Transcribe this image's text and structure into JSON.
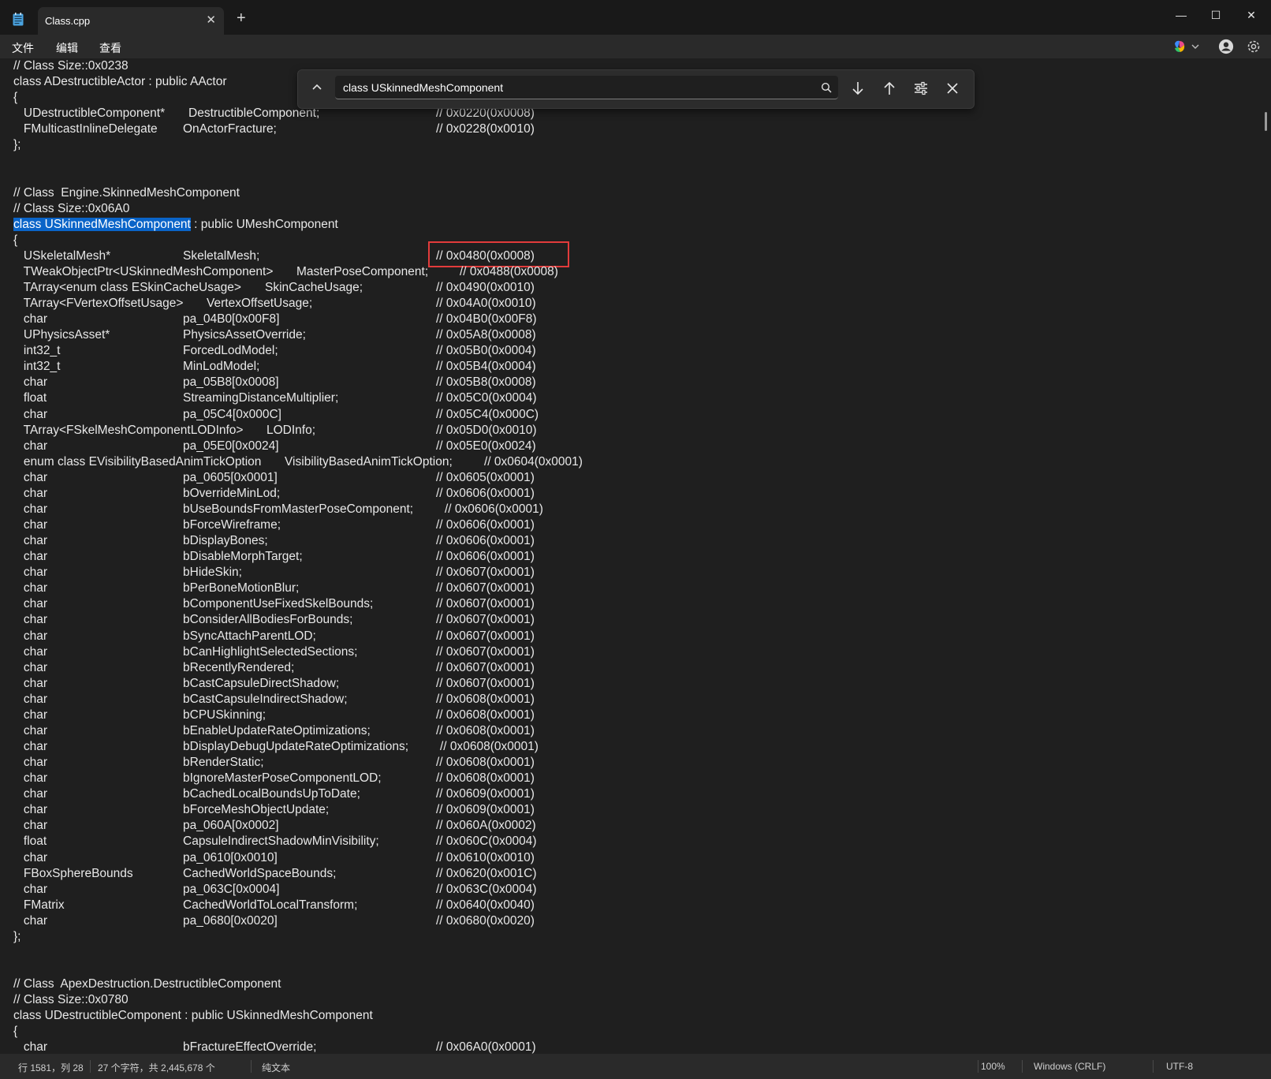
{
  "window": {
    "tab_title": "Class.cpp",
    "tab_close": "✕",
    "new_tab": "+",
    "minimize": "—",
    "maximize": "☐",
    "close": "✕"
  },
  "menu": {
    "file": "文件",
    "edit": "编辑",
    "view": "查看"
  },
  "find": {
    "query": "class USkinnedMeshComponent"
  },
  "editor": {
    "lines": [
      [
        "// Class Size::0x0238"
      ],
      [
        "class ADestructibleActor : public AActor"
      ],
      [
        "{"
      ],
      [
        "   UDestructibleComponent*",
        "DestructibleComponent;",
        "// 0x0220(0x0008)"
      ],
      [
        "   FMulticastInlineDelegate",
        "OnActorFracture;",
        "// 0x0228(0x0010)"
      ],
      [
        "};"
      ],
      [
        ""
      ],
      [
        ""
      ],
      [
        "// Class  Engine.SkinnedMeshComponent"
      ],
      [
        "// Class Size::0x06A0"
      ],
      [
        "class USkinnedMeshComponent",
        " : public UMeshComponent"
      ],
      [
        "{"
      ],
      [
        "   USkeletalMesh*",
        "SkeletalMesh;",
        "// 0x0480(0x0008)"
      ],
      [
        "   TWeakObjectPtr<USkinnedMeshComponent>",
        "MasterPoseComponent;",
        "// 0x0488(0x0008)"
      ],
      [
        "   TArray<enum class ESkinCacheUsage>",
        "SkinCacheUsage;",
        "// 0x0490(0x0010)"
      ],
      [
        "   TArray<FVertexOffsetUsage>",
        "VertexOffsetUsage;",
        "// 0x04A0(0x0010)"
      ],
      [
        "   char",
        "pa_04B0[0x00F8]",
        "// 0x04B0(0x00F8)"
      ],
      [
        "   UPhysicsAsset*",
        "PhysicsAssetOverride;",
        "// 0x05A8(0x0008)"
      ],
      [
        "   int32_t",
        "ForcedLodModel;",
        "// 0x05B0(0x0004)"
      ],
      [
        "   int32_t",
        "MinLodModel;",
        "// 0x05B4(0x0004)"
      ],
      [
        "   char",
        "pa_05B8[0x0008]",
        "// 0x05B8(0x0008)"
      ],
      [
        "   float",
        "StreamingDistanceMultiplier;",
        "// 0x05C0(0x0004)"
      ],
      [
        "   char",
        "pa_05C4[0x000C]",
        "// 0x05C4(0x000C)"
      ],
      [
        "   TArray<FSkelMeshComponentLODInfo>",
        "LODInfo;",
        "// 0x05D0(0x0010)"
      ],
      [
        "   char",
        "pa_05E0[0x0024]",
        "// 0x05E0(0x0024)"
      ],
      [
        "   enum class EVisibilityBasedAnimTickOption",
        "VisibilityBasedAnimTickOption;",
        "// 0x0604(0x0001)"
      ],
      [
        "   char",
        "pa_0605[0x0001]",
        "// 0x0605(0x0001)"
      ],
      [
        "   char",
        "bOverrideMinLod;",
        "// 0x0606(0x0001)"
      ],
      [
        "   char",
        "bUseBoundsFromMasterPoseComponent;",
        "// 0x0606(0x0001)"
      ],
      [
        "   char",
        "bForceWireframe;",
        "// 0x0606(0x0001)"
      ],
      [
        "   char",
        "bDisplayBones;",
        "// 0x0606(0x0001)"
      ],
      [
        "   char",
        "bDisableMorphTarget;",
        "// 0x0606(0x0001)"
      ],
      [
        "   char",
        "bHideSkin;",
        "// 0x0607(0x0001)"
      ],
      [
        "   char",
        "bPerBoneMotionBlur;",
        "// 0x0607(0x0001)"
      ],
      [
        "   char",
        "bComponentUseFixedSkelBounds;",
        "// 0x0607(0x0001)"
      ],
      [
        "   char",
        "bConsiderAllBodiesForBounds;",
        "// 0x0607(0x0001)"
      ],
      [
        "   char",
        "bSyncAttachParentLOD;",
        "// 0x0607(0x0001)"
      ],
      [
        "   char",
        "bCanHighlightSelectedSections;",
        "// 0x0607(0x0001)"
      ],
      [
        "   char",
        "bRecentlyRendered;",
        "// 0x0607(0x0001)"
      ],
      [
        "   char",
        "bCastCapsuleDirectShadow;",
        "// 0x0607(0x0001)"
      ],
      [
        "   char",
        "bCastCapsuleIndirectShadow;",
        "// 0x0608(0x0001)"
      ],
      [
        "   char",
        "bCPUSkinning;",
        "// 0x0608(0x0001)"
      ],
      [
        "   char",
        "bEnableUpdateRateOptimizations;",
        "// 0x0608(0x0001)"
      ],
      [
        "   char",
        "bDisplayDebugUpdateRateOptimizations;",
        "// 0x0608(0x0001)"
      ],
      [
        "   char",
        "bRenderStatic;",
        "// 0x0608(0x0001)"
      ],
      [
        "   char",
        "bIgnoreMasterPoseComponentLOD;",
        "// 0x0608(0x0001)"
      ],
      [
        "   char",
        "bCachedLocalBoundsUpToDate;",
        "// 0x0609(0x0001)"
      ],
      [
        "   char",
        "bForceMeshObjectUpdate;",
        "// 0x0609(0x0001)"
      ],
      [
        "   char",
        "pa_060A[0x0002]",
        "// 0x060A(0x0002)"
      ],
      [
        "   float",
        "CapsuleIndirectShadowMinVisibility;",
        "// 0x060C(0x0004)"
      ],
      [
        "   char",
        "pa_0610[0x0010]",
        "// 0x0610(0x0010)"
      ],
      [
        "   FBoxSphereBounds",
        "CachedWorldSpaceBounds;",
        "// 0x0620(0x001C)"
      ],
      [
        "   char",
        "pa_063C[0x0004]",
        "// 0x063C(0x0004)"
      ],
      [
        "   FMatrix",
        "CachedWorldToLocalTransform;",
        "// 0x0640(0x0040)"
      ],
      [
        "   char",
        "pa_0680[0x0020]",
        "// 0x0680(0x0020)"
      ],
      [
        "};"
      ],
      [
        ""
      ],
      [
        ""
      ],
      [
        "// Class  ApexDestruction.DestructibleComponent"
      ],
      [
        "// Class Size::0x0780"
      ],
      [
        "class UDestructibleComponent : public USkinnedMeshComponent"
      ],
      [
        "{"
      ],
      [
        "   char",
        "bFractureEffectOverride;",
        "// 0x06A0(0x0001)"
      ]
    ]
  },
  "status": {
    "position": "行 1581，列 28",
    "selection": "27 个字符，共 2,445,678 个",
    "format": "纯文本",
    "zoom": "100%",
    "line_ending": "Windows (CRLF)",
    "encoding": "UTF-8"
  },
  "colors": {
    "background": "#1f1f1f",
    "selection": "#0a64c8",
    "highlight_box": "#e23b3b",
    "text": "#e8e8e8"
  }
}
